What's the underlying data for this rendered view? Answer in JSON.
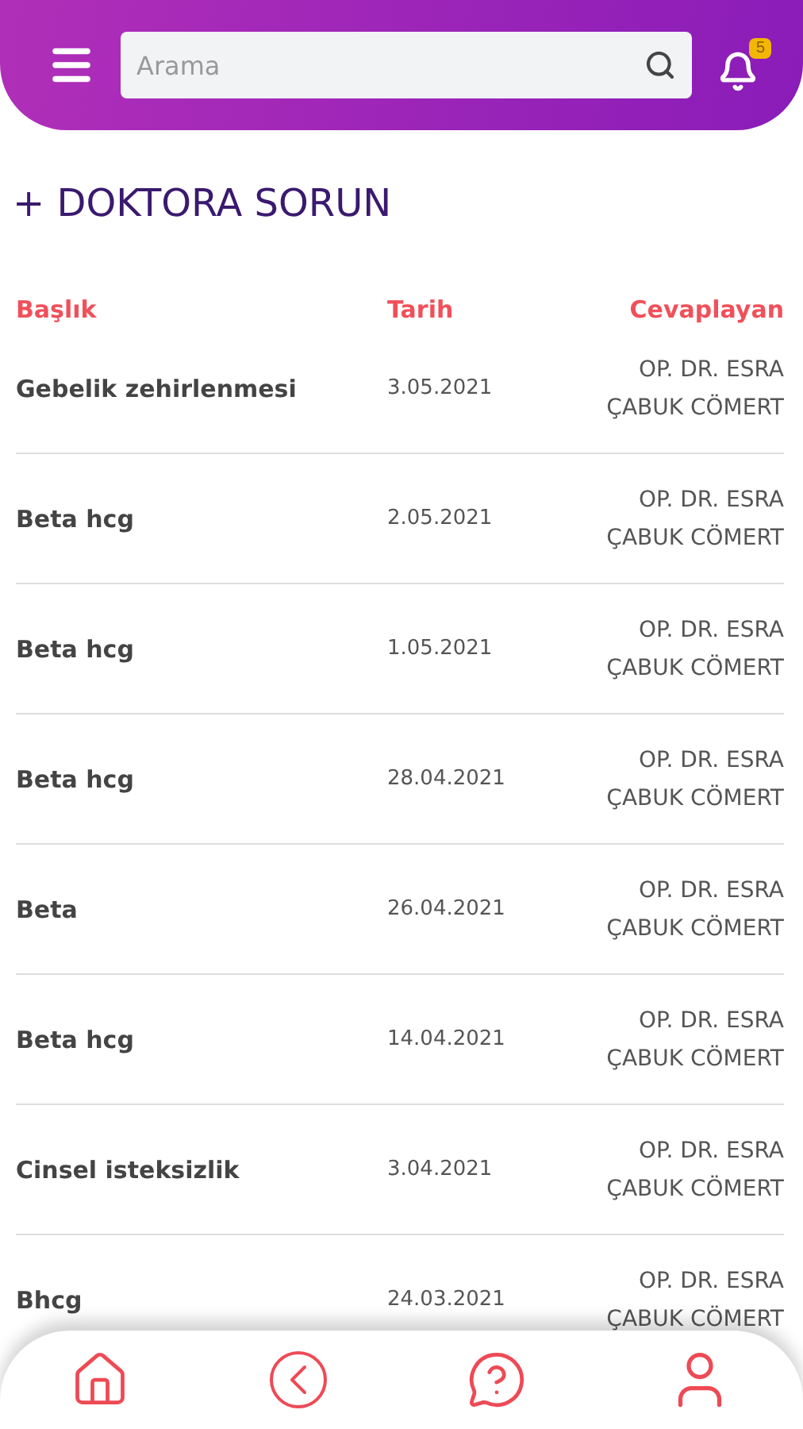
{
  "header": {
    "search": {
      "placeholder": "Arama"
    },
    "notifications": {
      "count": "5"
    }
  },
  "title": "+ DOKTORA SORUN",
  "table": {
    "columns": [
      "Başlık",
      "Tarih",
      "Cevaplayan"
    ],
    "rows": [
      {
        "subject": "Gebelik zehirlenmesi",
        "date": "3.05.2021",
        "answerer": [
          "OP. DR. ESRA",
          "ÇABUK CÖMERT"
        ]
      },
      {
        "subject": "Beta hcg",
        "date": "2.05.2021",
        "answerer": [
          "OP. DR. ESRA",
          "ÇABUK CÖMERT"
        ]
      },
      {
        "subject": "Beta hcg",
        "date": "1.05.2021",
        "answerer": [
          "OP. DR. ESRA",
          "ÇABUK CÖMERT"
        ]
      },
      {
        "subject": "Beta hcg",
        "date": "28.04.2021",
        "answerer": [
          "OP. DR. ESRA",
          "ÇABUK CÖMERT"
        ]
      },
      {
        "subject": "Beta",
        "date": "26.04.2021",
        "answerer": [
          "OP. DR. ESRA",
          "ÇABUK CÖMERT"
        ]
      },
      {
        "subject": "Beta hcg",
        "date": "14.04.2021",
        "answerer": [
          "OP. DR. ESRA",
          "ÇABUK CÖMERT"
        ]
      },
      {
        "subject": "Cinsel isteksizlik",
        "date": "3.04.2021",
        "answerer": [
          "OP. DR. ESRA",
          "ÇABUK CÖMERT"
        ]
      },
      {
        "subject": "Bhcg",
        "date": "24.03.2021",
        "answerer": [
          "OP. DR. ESRA",
          "ÇABUK CÖMERT"
        ]
      }
    ]
  },
  "bottom_nav": [
    {
      "kind": "home"
    },
    {
      "kind": "back"
    },
    {
      "kind": "help"
    },
    {
      "kind": "profile"
    }
  ]
}
